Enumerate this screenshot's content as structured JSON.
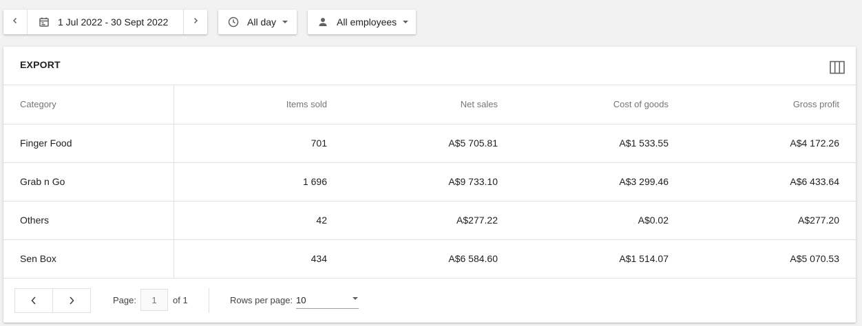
{
  "filters": {
    "date_range": "1 Jul 2022 - 30 Sept 2022",
    "time": "All day",
    "employees": "All employees"
  },
  "card": {
    "export_label": "EXPORT"
  },
  "table": {
    "headers": [
      "Category",
      "Items sold",
      "Net sales",
      "Cost of goods",
      "Gross profit"
    ],
    "rows": [
      [
        "Finger Food",
        "701",
        "A$5 705.81",
        "A$1 533.55",
        "A$4 172.26"
      ],
      [
        "Grab n Go",
        "1 696",
        "A$9 733.10",
        "A$3 299.46",
        "A$6 433.64"
      ],
      [
        "Others",
        "42",
        "A$277.22",
        "A$0.02",
        "A$277.20"
      ],
      [
        "Sen Box",
        "434",
        "A$6 584.60",
        "A$1 514.07",
        "A$5 070.53"
      ]
    ]
  },
  "pagination": {
    "page_label": "Page:",
    "page_value": "1",
    "of_label": "of 1",
    "rows_per_page_label": "Rows per page:",
    "rows_per_page_value": "10"
  },
  "colors": {
    "background": "#f2f2f2",
    "icon": "#616161",
    "divider": "#e0e0e0"
  }
}
